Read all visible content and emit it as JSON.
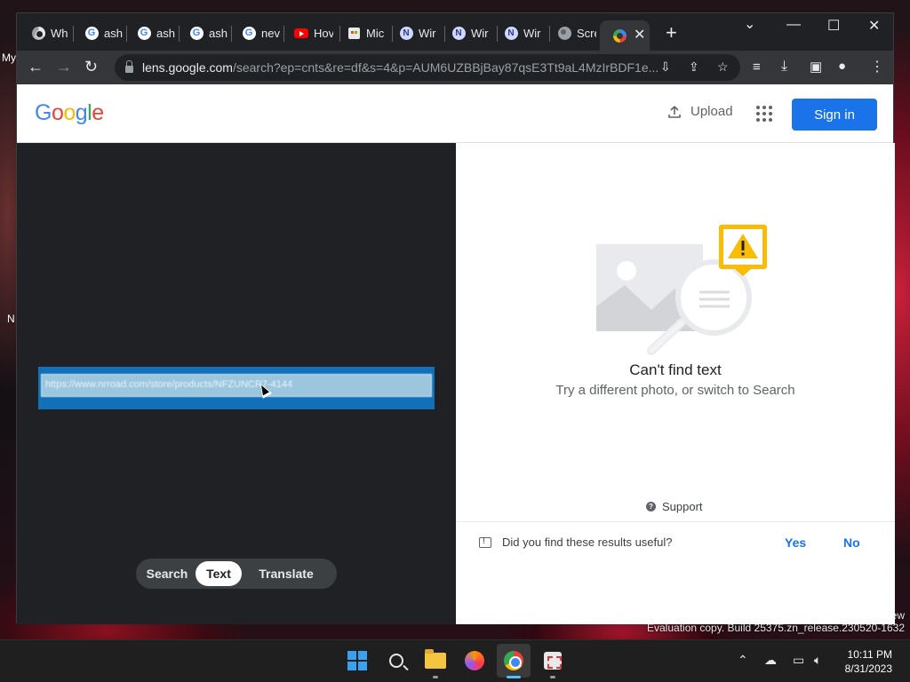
{
  "desktop": {
    "left_text_top": "My",
    "left_text_mid": "N",
    "right_text": "ew",
    "watermark": "Evaluation copy. Build 25375.zn_release.230520-1632"
  },
  "browser": {
    "tabs": [
      {
        "label": "Wh",
        "icon": "chrome-icon"
      },
      {
        "label": "ash",
        "icon": "google-icon"
      },
      {
        "label": "ash",
        "icon": "google-icon"
      },
      {
        "label": "ash",
        "icon": "google-icon"
      },
      {
        "label": "nev",
        "icon": "google-icon"
      },
      {
        "label": "Hov",
        "icon": "youtube-icon"
      },
      {
        "label": "Mic",
        "icon": "store-icon"
      },
      {
        "label": "Wir",
        "icon": "n-icon"
      },
      {
        "label": "Wir",
        "icon": "n-icon"
      },
      {
        "label": "Wir",
        "icon": "n-icon"
      },
      {
        "label": "Scre",
        "icon": "globe-icon"
      }
    ],
    "active_tab_icon": "google-lens-icon",
    "url_host": "lens.google.com",
    "url_rest": "/search?ep=cnts&re=df&s=4&p=AUM6UZBBjBay87qsE3Tt9aL4MzIrBDF1e..."
  },
  "lens": {
    "logo_letters": [
      {
        "ch": "G",
        "color": "#4285F4"
      },
      {
        "ch": "o",
        "color": "#EA4335"
      },
      {
        "ch": "o",
        "color": "#FBBC05"
      },
      {
        "ch": "g",
        "color": "#4285F4"
      },
      {
        "ch": "l",
        "color": "#34A853"
      },
      {
        "ch": "e",
        "color": "#EA4335"
      }
    ],
    "upload_label": "Upload",
    "signin_label": "Sign in",
    "image_text": "https://www.nrroad.com/store/products/NFZUNCR7-4144",
    "modes": [
      "Search",
      "Text",
      "Translate"
    ],
    "active_mode": "Text",
    "cant_find_title": "Can't find text",
    "cant_find_sub": "Try a different photo, or switch to Search",
    "support_label": "Support",
    "feedback_question": "Did you find these results useful?",
    "feedback_yes": "Yes",
    "feedback_no": "No"
  },
  "taskbar": {
    "time": "10:11 PM",
    "date": "8/31/2023"
  },
  "colors": {
    "accent": "#1a73e8",
    "warning": "#fbbc05"
  }
}
